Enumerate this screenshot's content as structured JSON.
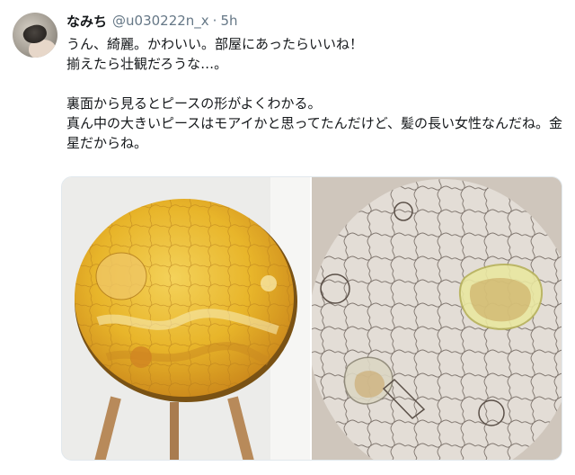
{
  "tweet": {
    "display_name": "なみち",
    "handle": "@u030222n_x",
    "separator": "·",
    "time": "5h",
    "lines": [
      "うん、綺麗。かわいい。部屋にあったらいいね！",
      "揃えたら壮観だろうな…。",
      "",
      "裏面から見るとピースの形がよくわかる。",
      "真ん中の大きいピースはモアイかと思ってたんだけど、髪の長い女性なんだね。金星だからね。"
    ]
  },
  "media": {
    "left_photo": "venus-puzzle-front-photo",
    "right_photo": "venus-puzzle-back-photo"
  },
  "colors": {
    "text": "#14171a",
    "secondary": "#657786",
    "border": "#e1e8ed",
    "puzzle_yellow": "#e8b52a",
    "puzzle_wood": "#d9d2ca"
  }
}
